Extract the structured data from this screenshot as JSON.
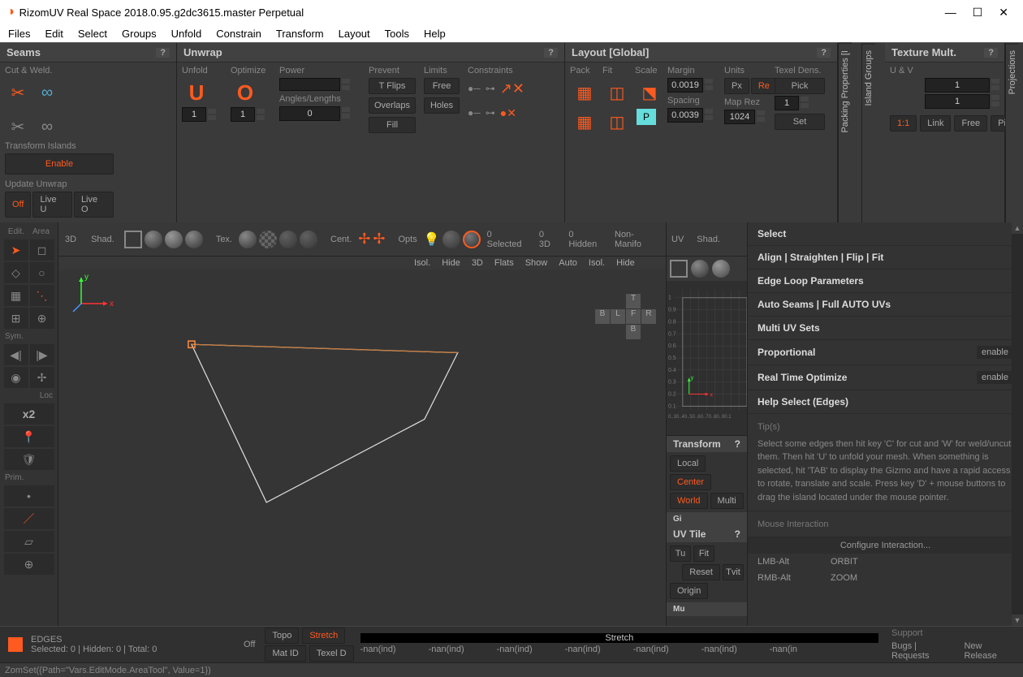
{
  "title": "RizomUV  Real Space 2018.0.95.g2dc3615.master Perpetual",
  "menu": [
    "Files",
    "Edit",
    "Select",
    "Groups",
    "Unfold",
    "Constrain",
    "Transform",
    "Layout",
    "Tools",
    "Help"
  ],
  "panels": {
    "seams": {
      "title": "Seams",
      "cutweld": "Cut & Weld.",
      "transform_islands": "Transform Islands",
      "enable": "Enable",
      "update_unwrap": "Update Unwrap",
      "off": "Off",
      "liveu": "Live U",
      "liveo": "Live O"
    },
    "unwrap": {
      "title": "Unwrap",
      "unfold": "Unfold",
      "optimize": "Optimize",
      "power": "Power",
      "prevent": "Prevent",
      "limits": "Limits",
      "constraints": "Constraints",
      "tflips": "T Flips",
      "free": "Free",
      "angles": "Angles/Lengths",
      "overlaps": "Overlaps",
      "holes": "Holes",
      "fill": "Fill",
      "v1": "1",
      "v2": "1",
      "v3": "0"
    },
    "layout": {
      "title": "Layout [Global]",
      "pack": "Pack",
      "fit": "Fit",
      "scale": "Scale",
      "margin": "Margin",
      "units": "Units",
      "texel": "Texel Dens.",
      "margin_v": "0.0019",
      "px": "Px",
      "re": "Re",
      "pick": "Pick",
      "spacing": "Spacing",
      "maprez": "Map Rez",
      "maprez_v": "1",
      "spacing_v": "0.0039",
      "rez_v": "1024",
      "set": "Set"
    },
    "texmult": {
      "title": "Texture Mult.",
      "uv": "U & V",
      "v1": "1",
      "v2": "1",
      "one": "1:1",
      "link": "Link",
      "free": "Free",
      "pic": "Pic"
    }
  },
  "side_tabs": [
    "Island Groups",
    "Packing Properties [I",
    "Projections"
  ],
  "left_labels": {
    "edit": "Edit.",
    "area": "Area",
    "sym": "Sym.",
    "loc": "Loc",
    "prim": "Prim."
  },
  "vp_toolbar": {
    "l1": "3D",
    "l2": "Shad.",
    "l3": "Tex.",
    "l4": "Cent.",
    "l5": "Opts",
    "r1": "0 Selected",
    "r2": "0 3D",
    "r3": "0 Hidden",
    "r4": "Non-Manifo",
    "t1": "Isol.",
    "t2": "Hide",
    "t3": "3D",
    "t4": "Flats",
    "t5": "Show",
    "t6": "Auto",
    "t7": "Isol.",
    "t8": "Hide"
  },
  "uv_toolbar": {
    "uv": "UV",
    "shad": "Shad."
  },
  "transform_panel": {
    "title": "Transform",
    "local": "Local",
    "center": "Center",
    "world": "World",
    "multi": "Multi"
  },
  "uvtile": {
    "title": "UV Tile",
    "tu": "Tu",
    "fit": "Fit",
    "tvit": "Tvit",
    "origin": "Origin",
    "reset": "Reset"
  },
  "gizmo": "Gi",
  "multiu": "Mu",
  "right": {
    "select": "Select",
    "align": "Align | Straighten | Flip | Fit",
    "edge_loop": "Edge Loop Parameters",
    "auto_seams": "Auto Seams | Full AUTO UVs",
    "multi_uv": "Multi UV Sets",
    "proportional": "Proportional",
    "realtime": "Real Time Optimize",
    "help_select": "Help Select (Edges)",
    "enable": "enable",
    "tips_hd": "Tip(s)",
    "tips": "Select some edges then hit key 'C' for cut and 'W' for weld/uncut them. Then hit 'U' to unfold your mesh. When something is selected, hit 'TAB' to display the Gizmo and have a rapid access to rotate, translate and scale. Press key 'D' + mouse buttons to drag the island located under the mouse pointer.",
    "mouse_hd": "Mouse Interaction",
    "configure": "Configure Interaction...",
    "lmb": "LMB-Alt",
    "lmb_v": "ORBIT",
    "rmb": "RMB-Alt",
    "rmb_v": "ZOOM"
  },
  "status": {
    "edges": "EDGES",
    "sel": "Selected: 0 | Hidden: 0 | Total: 0",
    "off": "Off",
    "topo": "Topo",
    "stretch": "Stretch",
    "matid": "Mat ID",
    "texeld": "Texel D",
    "stretch_bar": "Stretch",
    "nans": [
      "-nan(ind)",
      "-nan(ind)",
      "-nan(ind)",
      "-nan(ind)",
      "-nan(ind)",
      "-nan(ind)",
      "-nan(in"
    ],
    "support": "Support",
    "bugs": "Bugs | Requests",
    "newrel": "New Release"
  },
  "cmdline": "ZomSet({Path=\"Vars.EditMode.AreaTool\", Value=1})",
  "navcube": {
    "t": "T",
    "b_top": "B",
    "l": "L",
    "f": "F",
    "r": "R",
    "b": "B"
  }
}
